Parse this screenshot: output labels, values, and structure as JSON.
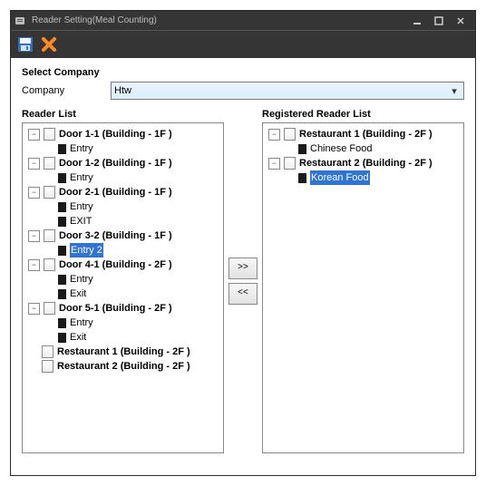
{
  "titlebar": {
    "title": "Reader Setting(Meal Counting)"
  },
  "toolbar": {
    "save": "save",
    "cancel": "cancel"
  },
  "section": {
    "title": "Select Company",
    "companyLabel": "Company",
    "companyValue": "Htw"
  },
  "left": {
    "title": "Reader List",
    "nodes": [
      {
        "label": "Door 1-1 (Building - 1F )",
        "children": [
          {
            "label": "Entry"
          }
        ]
      },
      {
        "label": "Door 1-2 (Building - 1F )",
        "children": [
          {
            "label": "Entry"
          }
        ]
      },
      {
        "label": "Door 2-1 (Building - 1F )",
        "children": [
          {
            "label": "Entry"
          },
          {
            "label": "EXIT"
          }
        ]
      },
      {
        "label": "Door 3-2 (Building - 1F )",
        "children": [
          {
            "label": "Entry 2",
            "selected": true
          }
        ]
      },
      {
        "label": "Door 4-1 (Building - 2F )",
        "children": [
          {
            "label": "Entry"
          },
          {
            "label": "Exit"
          }
        ]
      },
      {
        "label": "Door 5-1 (Building - 2F )",
        "children": [
          {
            "label": "Entry"
          },
          {
            "label": "Exit"
          }
        ]
      },
      {
        "label": "Restaurant 1 (Building - 2F )",
        "leaf": true
      },
      {
        "label": "Restaurant 2 (Building - 2F )",
        "leaf": true
      }
    ]
  },
  "right": {
    "title": "Registered Reader List",
    "nodes": [
      {
        "label": "Restaurant 1 (Building - 2F )",
        "children": [
          {
            "label": "Chinese Food"
          }
        ]
      },
      {
        "label": "Restaurant 2 (Building - 2F )",
        "children": [
          {
            "label": "Korean Food",
            "selected": true
          }
        ]
      }
    ]
  },
  "buttons": {
    "add": ">>",
    "remove": "<<"
  }
}
